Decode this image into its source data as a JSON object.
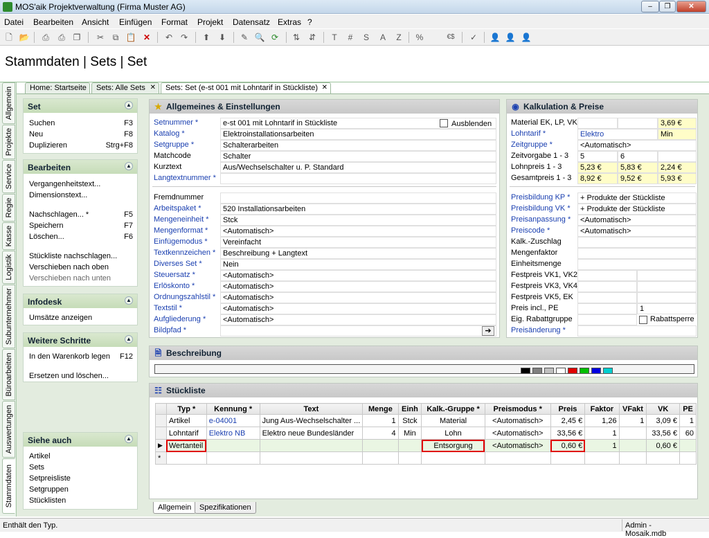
{
  "window": {
    "title": "MOS'aik Projektverwaltung (Firma Muster AG)",
    "min": "–",
    "restore": "❐",
    "close": "✕"
  },
  "menu": [
    "Datei",
    "Bearbeiten",
    "Ansicht",
    "Einfügen",
    "Format",
    "Projekt",
    "Datensatz",
    "Extras",
    "?"
  ],
  "toolbar": [
    "new",
    "open",
    "print",
    "preview",
    "copy",
    "cut",
    "copy2",
    "paste",
    "delete",
    "undo",
    "redo",
    "up",
    "down",
    "pen",
    "find",
    "refresh",
    "sort",
    "T",
    "#",
    "S",
    "A",
    "Z",
    "%",
    "1.1",
    "€$",
    "magic",
    "user-blue",
    "user-yellow",
    "user-red"
  ],
  "toolbar_glyphs": {
    "T": "T",
    "#": "#",
    "S": "S",
    "A": "A",
    "Z": "Z",
    "%": "%",
    "1.1": "1.1",
    "€$": "€$"
  },
  "page_title": "Stammdaten | Sets | Set",
  "tabs": [
    {
      "label": "Home: Startseite"
    },
    {
      "label": "Sets: Alle Sets"
    },
    {
      "label": "Sets: Set (e-st 001 mit Lohntarif in Stückliste)"
    }
  ],
  "vtabs": [
    "Allgemein",
    "Projekte",
    "Service",
    "Regie",
    "Kasse",
    "Logistik",
    "Subunternehmer",
    "Büroarbeiten",
    "Auswertungen",
    "Stammdaten"
  ],
  "left": {
    "set": {
      "title": "Set",
      "items": [
        {
          "label": "Suchen",
          "key": "F3"
        },
        {
          "label": "Neu",
          "key": "F8"
        },
        {
          "label": "Duplizieren",
          "key": "Strg+F8"
        }
      ]
    },
    "bearbeiten": {
      "title": "Bearbeiten",
      "items": [
        {
          "label": "Vergangenheitstext..."
        },
        {
          "label": "Dimensionstext..."
        },
        {
          "label": "Nachschlagen... *",
          "key": "F5"
        },
        {
          "label": "Speichern",
          "key": "F7"
        },
        {
          "label": "Löschen...",
          "key": "F6"
        },
        {
          "label": "Stückliste nachschlagen..."
        },
        {
          "label": "Verschieben nach oben"
        },
        {
          "label": "Verschieben nach unten"
        }
      ]
    },
    "infodesk": {
      "title": "Infodesk",
      "items": [
        {
          "label": "Umsätze anzeigen"
        }
      ]
    },
    "weitere": {
      "title": "Weitere Schritte",
      "items": [
        {
          "label": "In den Warenkorb legen",
          "key": "F12"
        },
        {
          "label": "Ersetzen und löschen..."
        }
      ]
    },
    "siehe": {
      "title": "Siehe auch",
      "items": [
        {
          "label": "Artikel"
        },
        {
          "label": "Sets"
        },
        {
          "label": "Setpreisliste"
        },
        {
          "label": "Setgruppen"
        },
        {
          "label": "Stücklisten"
        }
      ]
    }
  },
  "allgemein": {
    "title": "Allgemeines & Einstellungen",
    "ausblenden": "Ausblenden",
    "fields1": [
      {
        "label": "Setnummer *",
        "value": "e-st 001 mit Lohntarif in Stückliste",
        "blue": true
      },
      {
        "label": "Katalog *",
        "value": "Elektroinstallationsarbeiten",
        "blue": true
      },
      {
        "label": "Setgruppe *",
        "value": "Schalterarbeiten",
        "blue": true
      },
      {
        "label": "Matchcode",
        "value": "Schalter",
        "blue": false
      },
      {
        "label": "Kurztext",
        "value": "Aus/Wechselschalter u. P. Standard",
        "blue": false
      },
      {
        "label": "Langtextnummer *",
        "value": "",
        "blue": true
      }
    ],
    "fields2": [
      {
        "label": "Fremdnummer",
        "value": "",
        "blue": false
      },
      {
        "label": "Arbeitspaket *",
        "value": "520 Installationsarbeiten",
        "blue": true
      },
      {
        "label": "Mengeneinheit *",
        "value": "Stck",
        "blue": true
      },
      {
        "label": "Mengenformat *",
        "value": "<Automatisch>",
        "blue": true
      },
      {
        "label": "Einfügemodus *",
        "value": "Vereinfacht",
        "blue": true
      },
      {
        "label": "Textkennzeichen *",
        "value": "Beschreibung + Langtext",
        "blue": true
      },
      {
        "label": "Diverses Set *",
        "value": "Nein",
        "blue": true
      },
      {
        "label": "Steuersatz *",
        "value": "<Automatisch>",
        "blue": true
      },
      {
        "label": "Erlöskonto *",
        "value": "<Automatisch>",
        "blue": true
      },
      {
        "label": "Ordnungszahlstil *",
        "value": "<Automatisch>",
        "blue": true
      },
      {
        "label": "Textstil *",
        "value": "<Automatisch>",
        "blue": true
      },
      {
        "label": "Aufgliederung *",
        "value": "<Automatisch>",
        "blue": true
      },
      {
        "label": "Bildpfad *",
        "value": "",
        "blue": true
      }
    ],
    "arrow": "➔"
  },
  "kalkulation": {
    "title": "Kalkulation & Preise",
    "mat": {
      "label": "Material EK, LP, VK",
      "v3": "3,69 €"
    },
    "lohntarif": {
      "label": "Lohntarif *",
      "v1": "Elektro",
      "v2": "Min"
    },
    "zeitgruppe": {
      "label": "Zeitgruppe *",
      "value": "<Automatisch>"
    },
    "zeitvorgabe": {
      "label": "Zeitvorgabe 1 - 3",
      "v1": "5",
      "v2": "6"
    },
    "lohnpreis": {
      "label": "Lohnpreis 1 - 3",
      "v1": "5,23 €",
      "v2": "5,83 €",
      "v3": "2,24 €"
    },
    "gesamtpreis": {
      "label": "Gesamtpreis 1 - 3",
      "v1": "8,92 €",
      "v2": "9,52 €",
      "v3": "5,93 €"
    },
    "fields2": [
      {
        "label": "Preisbildung KP *",
        "value": "+ Produkte der Stückliste",
        "blue": true
      },
      {
        "label": "Preisbildung VK *",
        "value": "+ Produkte der Stückliste",
        "blue": true
      },
      {
        "label": "Preisanpassung *",
        "value": "<Automatisch>",
        "blue": true
      },
      {
        "label": "Preiscode *",
        "value": "<Automatisch>",
        "blue": true
      },
      {
        "label": "Kalk.-Zuschlag",
        "value": "",
        "blue": false
      },
      {
        "label": "Mengenfaktor",
        "value": "",
        "blue": false
      },
      {
        "label": "Einheitsmenge",
        "value": "",
        "blue": false
      }
    ],
    "festpreise": [
      "Festpreis VK1, VK2",
      "Festpreis VK3, VK4",
      "Festpreis VK5, EK"
    ],
    "preisincl": {
      "label": "Preis incl., PE",
      "v2": "1"
    },
    "rabatt": {
      "label": "Eig. Rabattgruppe",
      "chk": "Rabattsperre"
    },
    "preisaenderung": "Preisänderung *"
  },
  "beschreibung": {
    "title": "Beschreibung"
  },
  "stueckliste": {
    "title": "Stückliste",
    "columns": [
      "Typ *",
      "Kennung *",
      "Text",
      "Menge",
      "Einh",
      "Kalk.-Gruppe *",
      "Preismodus *",
      "Preis",
      "Faktor",
      "VFakt",
      "VK",
      "PE"
    ],
    "rows": [
      {
        "typ": "Artikel",
        "kennung": "e-04001",
        "text": "Jung Aus-Wechselschalter ...",
        "menge": "1",
        "einh": "Stck",
        "kalk": "Material",
        "preismodus": "<Automatisch>",
        "preis": "2,45 €",
        "faktor": "1,26",
        "vfakt": "1",
        "vk": "3,09 €",
        "pe": "1"
      },
      {
        "typ": "Lohntarif",
        "kennung": "Elektro NB",
        "text": "Elektro neue Bundesländer",
        "menge": "4",
        "einh": "Min",
        "kalk": "Lohn",
        "preismodus": "<Automatisch>",
        "preis": "33,56 €",
        "faktor": "1",
        "vfakt": "",
        "vk": "33,56 €",
        "pe": "60"
      },
      {
        "typ": "Wertanteil",
        "kennung": "",
        "text": "",
        "menge": "",
        "einh": "",
        "kalk": "Entsorgung",
        "preismodus": "<Automatisch>",
        "preis": "0,60 €",
        "faktor": "1",
        "vfakt": "",
        "vk": "0,60 €",
        "pe": ""
      }
    ],
    "new_marker": "*",
    "current_marker": "▶"
  },
  "bottom_tabs": [
    "Allgemein",
    "Spezifikationen"
  ],
  "status": {
    "left": "Enthält den Typ.",
    "right": "Admin - Mosaik.mdb"
  }
}
